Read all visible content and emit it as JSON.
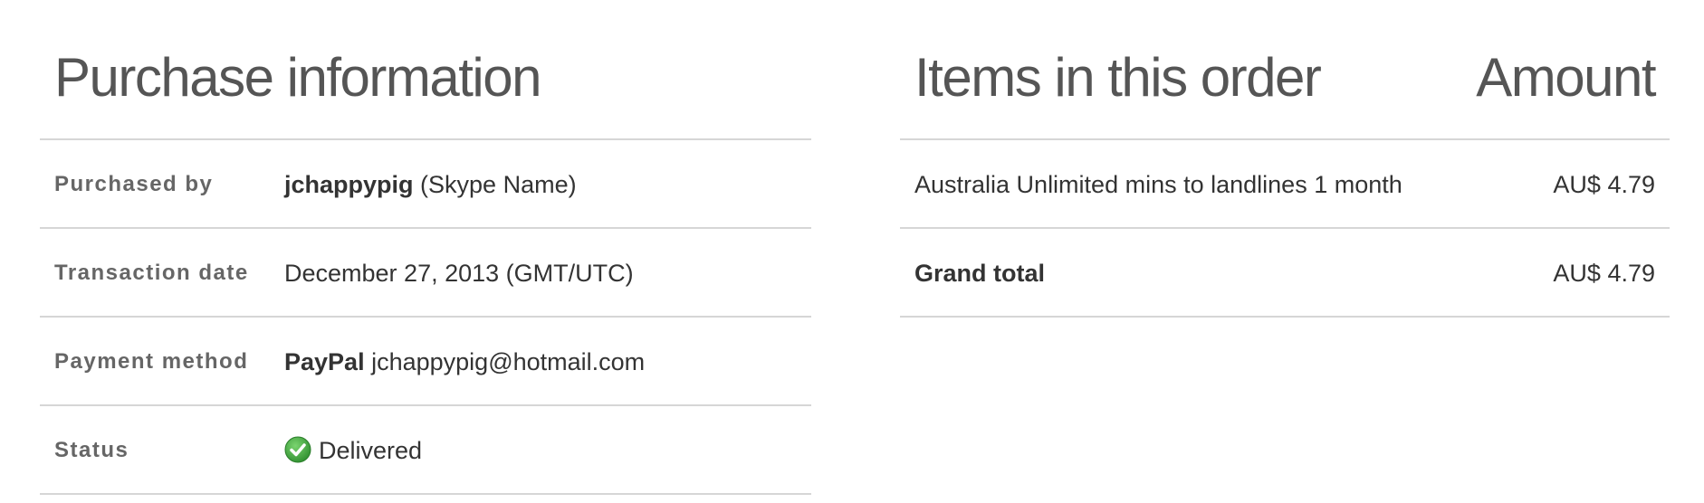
{
  "purchase_info": {
    "title": "Purchase information",
    "purchased_by": {
      "label": "Purchased by",
      "username": "jchappypig",
      "suffix": "(Skype Name)"
    },
    "transaction_date": {
      "label": "Transaction date",
      "value": "December 27, 2013 (GMT/UTC)"
    },
    "payment_method": {
      "label": "Payment method",
      "provider": "PayPal",
      "account": "jchappypig@hotmail.com"
    },
    "status": {
      "label": "Status",
      "icon": "check-circle-icon",
      "value": "Delivered",
      "icon_color": "#3aa63a"
    }
  },
  "order": {
    "title": "Items in this order",
    "amount_header": "Amount",
    "items": [
      {
        "name": "Australia Unlimited mins to landlines 1 month",
        "amount": "AU$ 4.79"
      }
    ],
    "grand_total": {
      "label": "Grand total",
      "amount": "AU$ 4.79"
    }
  }
}
